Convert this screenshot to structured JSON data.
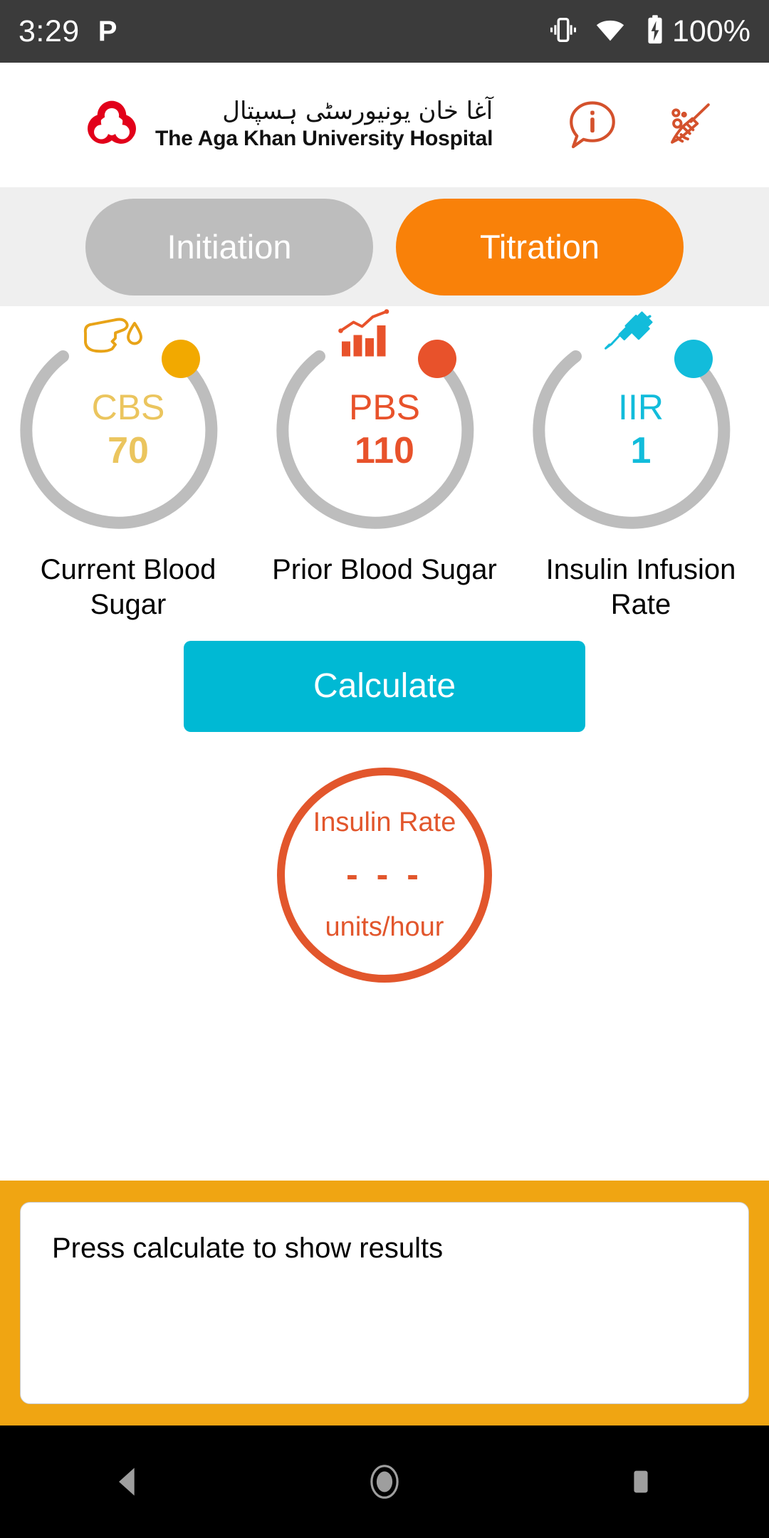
{
  "status_bar": {
    "time": "3:29",
    "left_badge": "P",
    "battery_percent": "100%",
    "icons": [
      "vibrate-icon",
      "wifi-icon",
      "battery-charging-icon"
    ]
  },
  "header": {
    "logo_urdu": "آغا خان یونیورسٹی ہسپتال",
    "logo_english": "The Aga Khan University Hospital",
    "actions": [
      {
        "name": "info-icon",
        "label": "i"
      },
      {
        "name": "broom-icon",
        "label": ""
      }
    ]
  },
  "tabs": [
    {
      "label": "Initiation",
      "active": false
    },
    {
      "label": "Titration",
      "active": true
    }
  ],
  "gauges": [
    {
      "abbr": "CBS",
      "value": "70",
      "label": "Current Blood Sugar",
      "color": "#ebc55e",
      "knob_color": "#f2a900",
      "icon": "finger-blood-drop-icon"
    },
    {
      "abbr": "PBS",
      "value": "110",
      "label": "Prior Blood Sugar",
      "color": "#e8522b",
      "knob_color": "#e8522b",
      "icon": "bar-chart-trend-icon"
    },
    {
      "abbr": "IIR",
      "value": "1",
      "label": "Insulin Infusion Rate",
      "color": "#12bcdb",
      "knob_color": "#12bcdb",
      "icon": "syringe-icon"
    }
  ],
  "calculate_button": {
    "label": "Calculate",
    "color": "#00b9d4"
  },
  "result": {
    "title": "Insulin Rate",
    "value": "- - -",
    "units": "units/hour",
    "color": "#e2562c"
  },
  "results_panel": {
    "message": "Press calculate to show results",
    "background_color": "#f0a512"
  },
  "nav_bar": {
    "buttons": [
      "back-button",
      "home-button",
      "recents-button"
    ]
  }
}
